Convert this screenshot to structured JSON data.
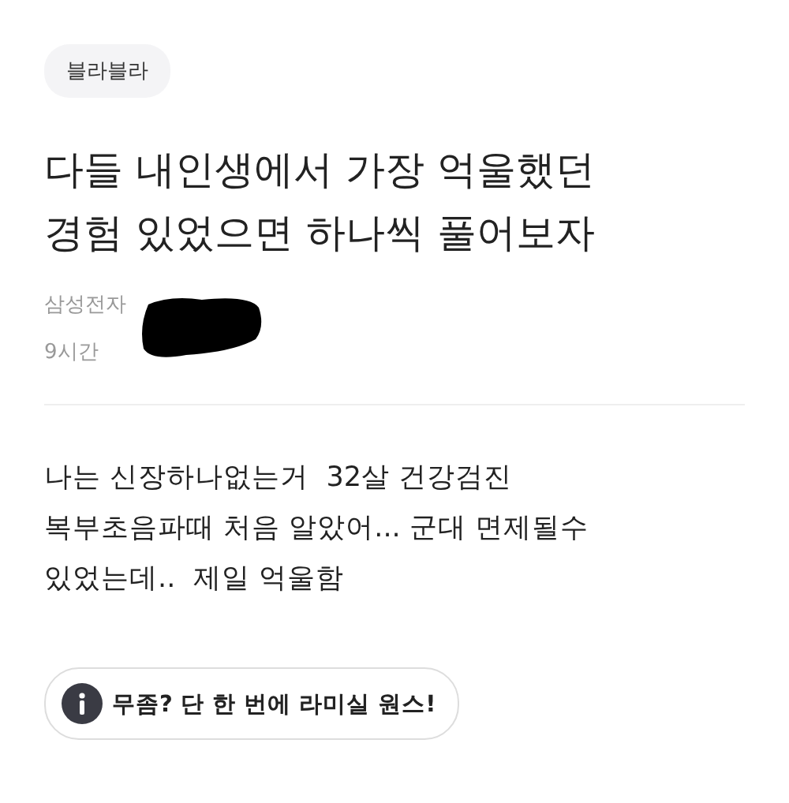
{
  "tag": "블라블라",
  "title_lines": [
    "다들 내인생에서 가장 억울했던",
    "경험 있었으면 하나씩 풀어보자"
  ],
  "author": {
    "company": "삼성전자",
    "time": "9시간"
  },
  "body_lines": [
    "나는 신장하나없는거  32살 건강검진",
    "복부초음파때 처음 알았어... 군대 면제될수",
    "있었는데..  제일 억울함"
  ],
  "promo": {
    "label": "무좀? 단 한 번에 라미실 원스!"
  }
}
